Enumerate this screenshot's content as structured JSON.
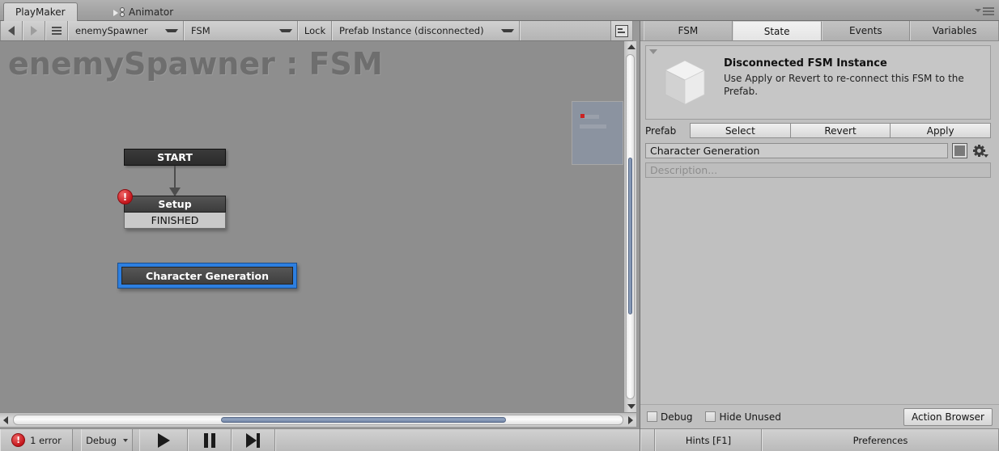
{
  "window": {
    "tabs": [
      {
        "label": "PlayMaker",
        "active": true,
        "icon": ""
      },
      {
        "label": "Animator",
        "active": false,
        "icon": "animator-icon"
      }
    ],
    "menu_icon": "window-menu-icon"
  },
  "toolbar": {
    "back_icon": "arrow-left-icon",
    "forward_icon": "arrow-right-icon",
    "menu_icon": "hamburger-icon",
    "object_selector": "enemySpawner",
    "fsm_selector": "FSM",
    "lock_label": "Lock",
    "prefab_status": "Prefab Instance (disconnected)",
    "layout_icon": "layout-icon"
  },
  "graph": {
    "title": "enemySpawner : FSM",
    "minimap_icon": "minimap",
    "nodes": [
      {
        "name": "START",
        "type": "start",
        "error": false,
        "selected": false,
        "events": []
      },
      {
        "name": "Setup",
        "type": "state",
        "error": true,
        "error_badge": "!",
        "selected": false,
        "events": [
          "FINISHED"
        ]
      },
      {
        "name": "Character Generation",
        "type": "state",
        "error": false,
        "selected": true,
        "events": []
      }
    ],
    "vertical_scrollbar": "vertical-scrollbar",
    "horizontal_scrollbar": "horizontal-scrollbar"
  },
  "statusbar": {
    "error_count": "1 error",
    "error_icon": "error-icon",
    "debug_label": "Debug",
    "play_icon": "play-icon",
    "pause_icon": "pause-icon",
    "step_icon": "step-icon"
  },
  "inspector": {
    "tabs": [
      {
        "label": "FSM",
        "active": false
      },
      {
        "label": "State",
        "active": true
      },
      {
        "label": "Events",
        "active": false
      },
      {
        "label": "Variables",
        "active": false
      }
    ],
    "prefab_notice": {
      "icon": "prefab-cube-icon",
      "title": "Disconnected FSM Instance",
      "body": "Use Apply or Revert to re-connect this FSM to the Prefab.",
      "foldout_icon": "foldout-caret-icon"
    },
    "prefab_row": {
      "label": "Prefab",
      "buttons": [
        "Select",
        "Revert",
        "Apply"
      ]
    },
    "state_name": {
      "value": "Character Generation",
      "color_swatch": "#7a7a7a",
      "color_swatch_icon": "color-swatch",
      "settings_icon": "gear-icon"
    },
    "description": {
      "placeholder": "Description..."
    },
    "footer": {
      "debug_label": "Debug",
      "debug_checked": false,
      "hide_unused_label": "Hide Unused",
      "hide_unused_checked": false,
      "action_browser_label": "Action Browser"
    },
    "statusbar": {
      "hints_label": "Hints [F1]",
      "preferences_label": "Preferences"
    }
  },
  "colors": {
    "canvas_bg": "#8e8e8e",
    "panel_bg": "#c0c0c0",
    "selection_blue": "#2d7fe0",
    "error_red": "#c4161c",
    "scrollbar_thumb": "#7f92b1"
  }
}
